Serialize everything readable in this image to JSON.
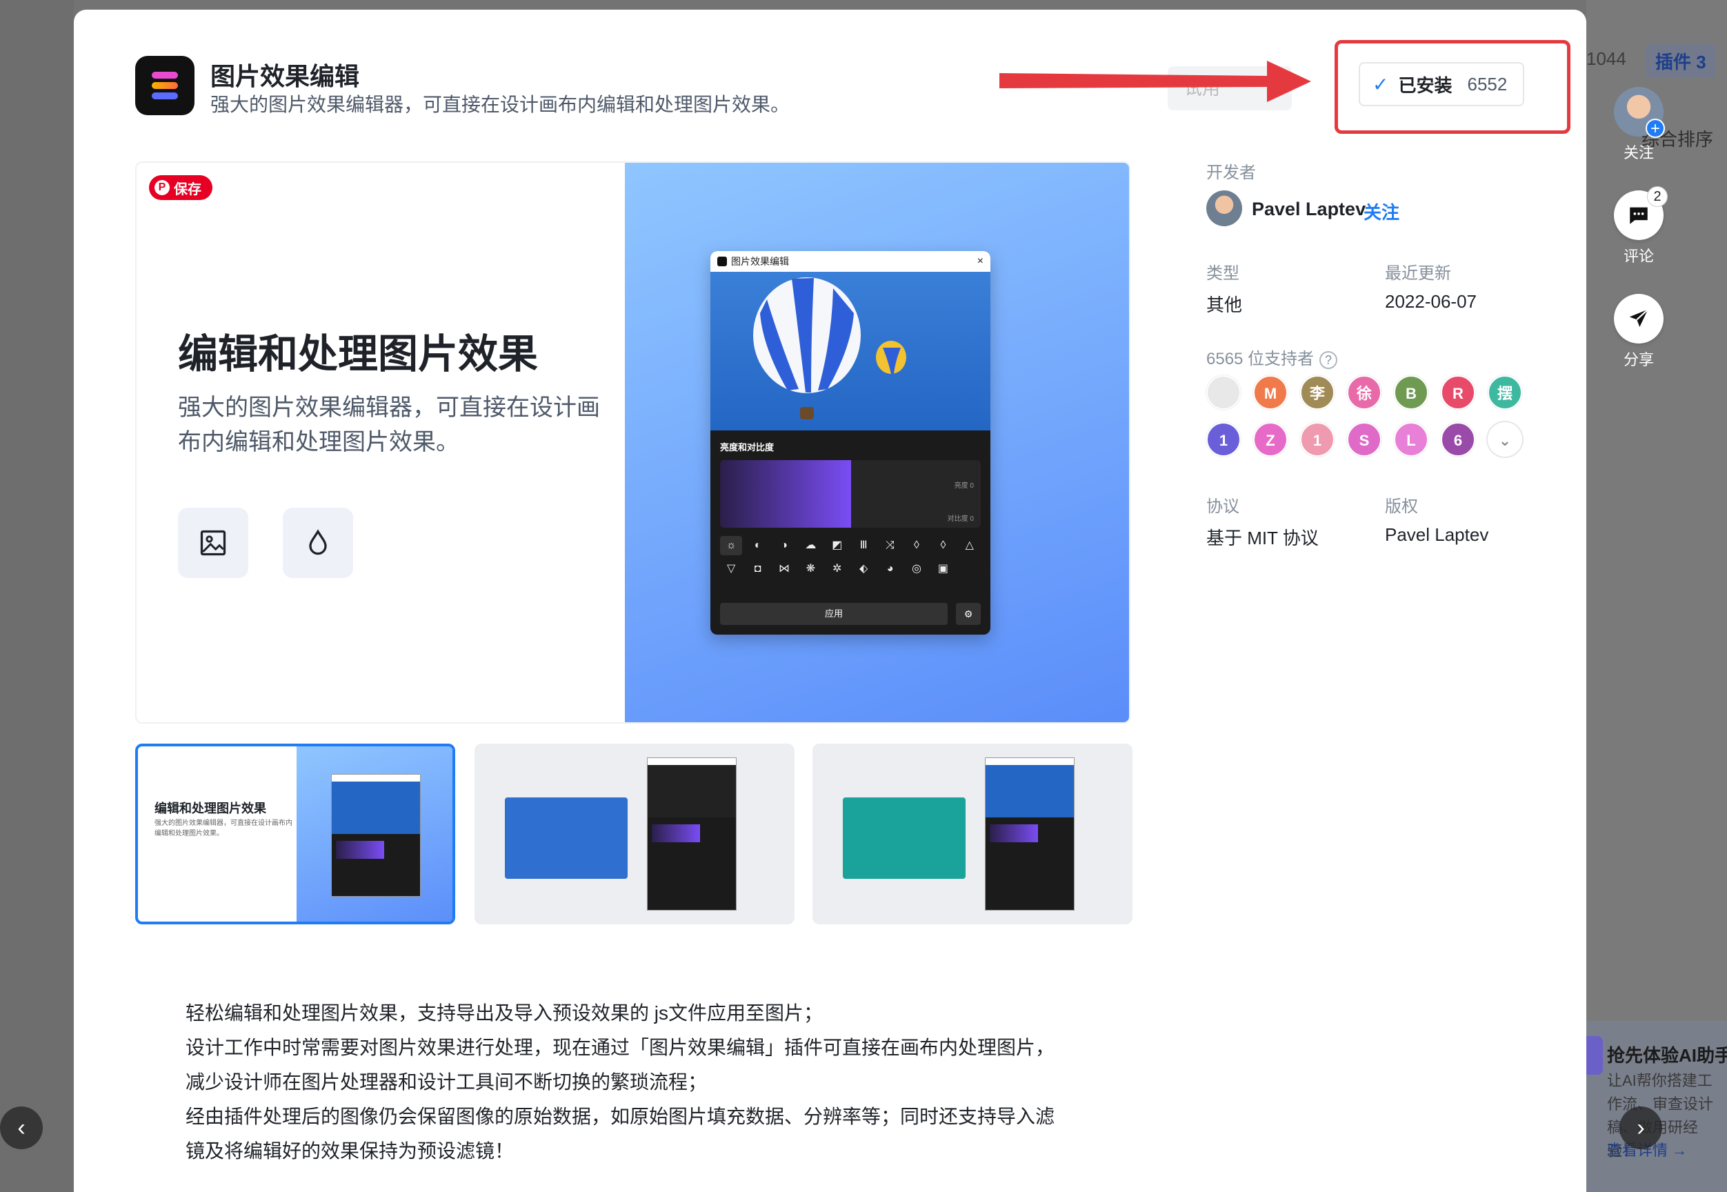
{
  "background": {
    "tab_count": "1044",
    "tab_plugins": "插件 3",
    "sort_label": "综合排序",
    "ai_card": {
      "title": "抢先体验AI助手",
      "desc": "让AI帮你搭建工作流、审查设计稿、做用研经验！",
      "link": "查看详情 →"
    }
  },
  "side_actions": {
    "follow": "关注",
    "comment": "评论",
    "comment_count": "2",
    "share": "分享"
  },
  "plugin": {
    "title": "图片效果编辑",
    "subtitle": "强大的图片效果编辑器，可直接在设计画布内编辑和处理图片效果。",
    "ghost_button": "试用",
    "installed_label": "已安装",
    "install_count": "6552",
    "save_badge": "保存"
  },
  "preview": {
    "heading": "编辑和处理图片效果",
    "subtitle": "强大的图片效果编辑器，可直接在设计画布内编辑和处理图片效果。",
    "mini_window": {
      "title": "图片效果编辑",
      "section": "亮度和对比度",
      "brightness_label": "亮度 0",
      "contrast_label": "对比度 0",
      "apply": "应用",
      "icons": [
        "☼",
        "◐",
        "◑",
        "☁",
        "◩",
        "Ⅲ",
        "⤨",
        "◊",
        "◊",
        "△",
        "▽",
        "◘",
        "⋈",
        "❋",
        "✲",
        "⬖",
        "◕",
        "◎",
        "▣"
      ]
    }
  },
  "thumbnails": [
    {
      "title": "编辑和处理图片效果",
      "subtitle": "强大的图片效果编辑器，可直接在设计画布内编辑和处理图片效果。"
    },
    {
      "title": "",
      "subtitle": ""
    },
    {
      "title": "",
      "subtitle": ""
    }
  ],
  "info": {
    "developer_label": "开发者",
    "developer_name": "Pavel Laptev",
    "follow": "关注",
    "type_label": "类型",
    "type_value": "其他",
    "updated_label": "最近更新",
    "updated_value": "2022-06-07",
    "supporters_label": "6565 位支持者",
    "supporters": [
      {
        "text": "",
        "color": "#e8e8e8"
      },
      {
        "text": "M",
        "color": "#f07a4a"
      },
      {
        "text": "李",
        "color": "#a08a56"
      },
      {
        "text": "徐",
        "color": "#e86aa8"
      },
      {
        "text": "B",
        "color": "#6f9a52"
      },
      {
        "text": "R",
        "color": "#e84a6a"
      },
      {
        "text": "摆",
        "color": "#3fb8a0"
      },
      {
        "text": "1",
        "color": "#6a5fd8"
      },
      {
        "text": "Z",
        "color": "#e86ac8"
      },
      {
        "text": "1",
        "color": "#f09ab0"
      },
      {
        "text": "S",
        "color": "#e06ac8"
      },
      {
        "text": "L",
        "color": "#e880d8"
      },
      {
        "text": "6",
        "color": "#9a4aa8"
      }
    ],
    "license_label": "协议",
    "license_value": "基于 MIT 协议",
    "copyright_label": "版权",
    "copyright_value": "Pavel Laptev"
  },
  "description": [
    "轻松编辑和处理图片效果，支持导出及导入预设效果的 js文件应用至图片；",
    "设计工作中时常需要对图片效果进行处理，现在通过「图片效果编辑」插件可直接在画布内处理图片，",
    "减少设计师在图片处理器和设计工具间不断切换的繁琐流程；",
    "经由插件处理后的图像仍会保留图像的原始数据，如原始图片填充数据、分辨率等；同时还支持导入滤",
    "镜及将编辑好的效果保持为预设滤镜！"
  ],
  "colors": {
    "accent": "#1f7cf5",
    "highlight": "#e43a3f"
  }
}
